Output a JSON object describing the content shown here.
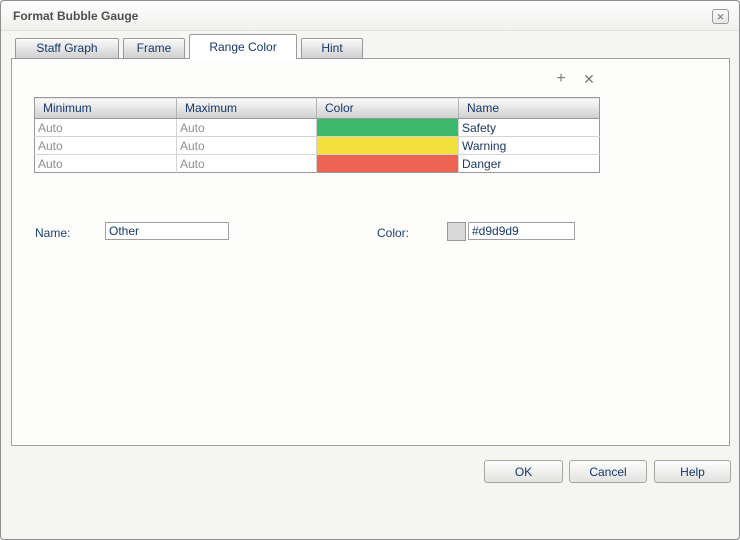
{
  "dialog": {
    "title": "Format Bubble Gauge"
  },
  "icons": {
    "close": "✕",
    "add": "+",
    "delete": "✕"
  },
  "tabs": [
    {
      "label": "Staff Graph",
      "active": false
    },
    {
      "label": "Frame",
      "active": false
    },
    {
      "label": "Range Color",
      "active": true
    },
    {
      "label": "Hint",
      "active": false
    }
  ],
  "range_color": {
    "table": {
      "columns": [
        "Minimum",
        "Maximum",
        "Color",
        "Name"
      ],
      "rows": [
        {
          "minimum": "Auto",
          "maximum": "Auto",
          "color": "#3cb96a",
          "name": "Safety"
        },
        {
          "minimum": "Auto",
          "maximum": "Auto",
          "color": "#f2e03c",
          "name": "Warning"
        },
        {
          "minimum": "Auto",
          "maximum": "Auto",
          "color": "#ec6350",
          "name": "Danger"
        }
      ]
    },
    "name_field": {
      "label": "Name:",
      "value": "Other"
    },
    "color_field": {
      "label": "Color:",
      "value": "#d9d9d9",
      "swatch_color": "#d9d9d9"
    }
  },
  "footer": {
    "ok_label": "OK",
    "cancel_label": "Cancel",
    "help_label": "Help"
  }
}
